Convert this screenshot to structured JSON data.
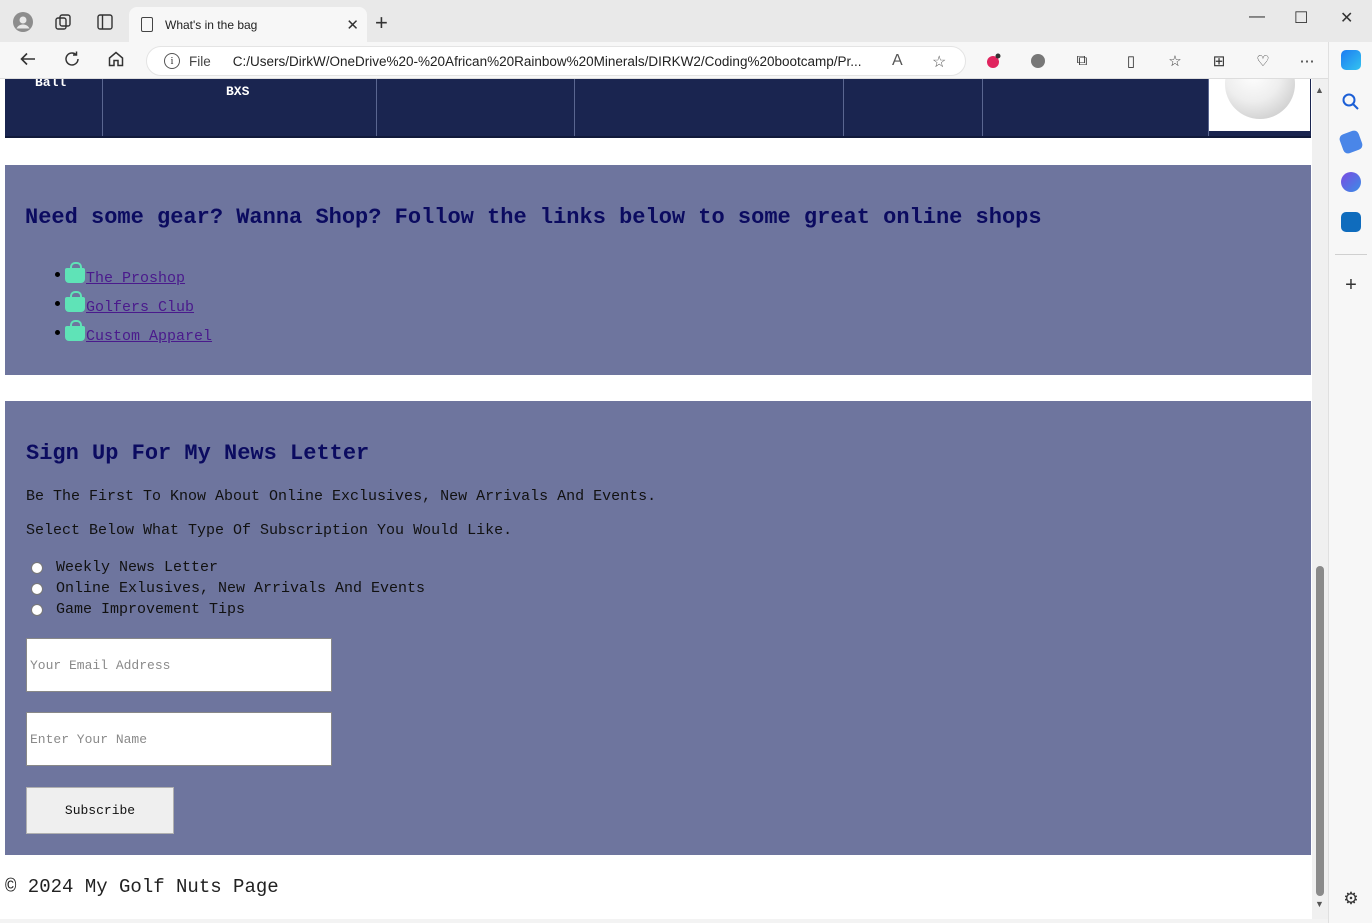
{
  "browser": {
    "tab_title": "What's in the bag",
    "address_scheme": "File",
    "address_path": "C:/Users/DirkW/OneDrive%20-%20African%20Rainbow%20Minerals/DIRKW2/Coding%20bootcamp/Pr..."
  },
  "gear_table": {
    "cells": [
      "Ball",
      "BXS",
      "",
      "",
      "",
      "",
      ""
    ]
  },
  "shop": {
    "heading": "Need some gear? Wanna Shop? Follow the links below to some great online shops",
    "links": [
      {
        "label": "The Proshop"
      },
      {
        "label": "Golfers Club"
      },
      {
        "label": "Custom Apparel"
      }
    ],
    "icon_color": "#5fe3b7"
  },
  "signup": {
    "heading": "Sign Up For My News Letter",
    "intro": "Be The First To Know About Online Exclusives, New Arrivals And Events.",
    "instruction": "Select Below What Type Of Subscription You Would Like.",
    "options": [
      {
        "label": "Weekly News Letter",
        "checked": false
      },
      {
        "label": "Online Exlusives, New Arrivals And Events",
        "checked": false
      },
      {
        "label": "Game Improvement Tips",
        "checked": false
      }
    ],
    "email_placeholder": "Your Email Address",
    "name_placeholder": "Enter Your Name",
    "button_label": "Subscribe"
  },
  "footer": {
    "text": "© 2024 My Golf Nuts Page"
  },
  "colors": {
    "section_bg": "#6e759e",
    "heading": "#0b0b60",
    "table_bg": "#1a2550"
  }
}
